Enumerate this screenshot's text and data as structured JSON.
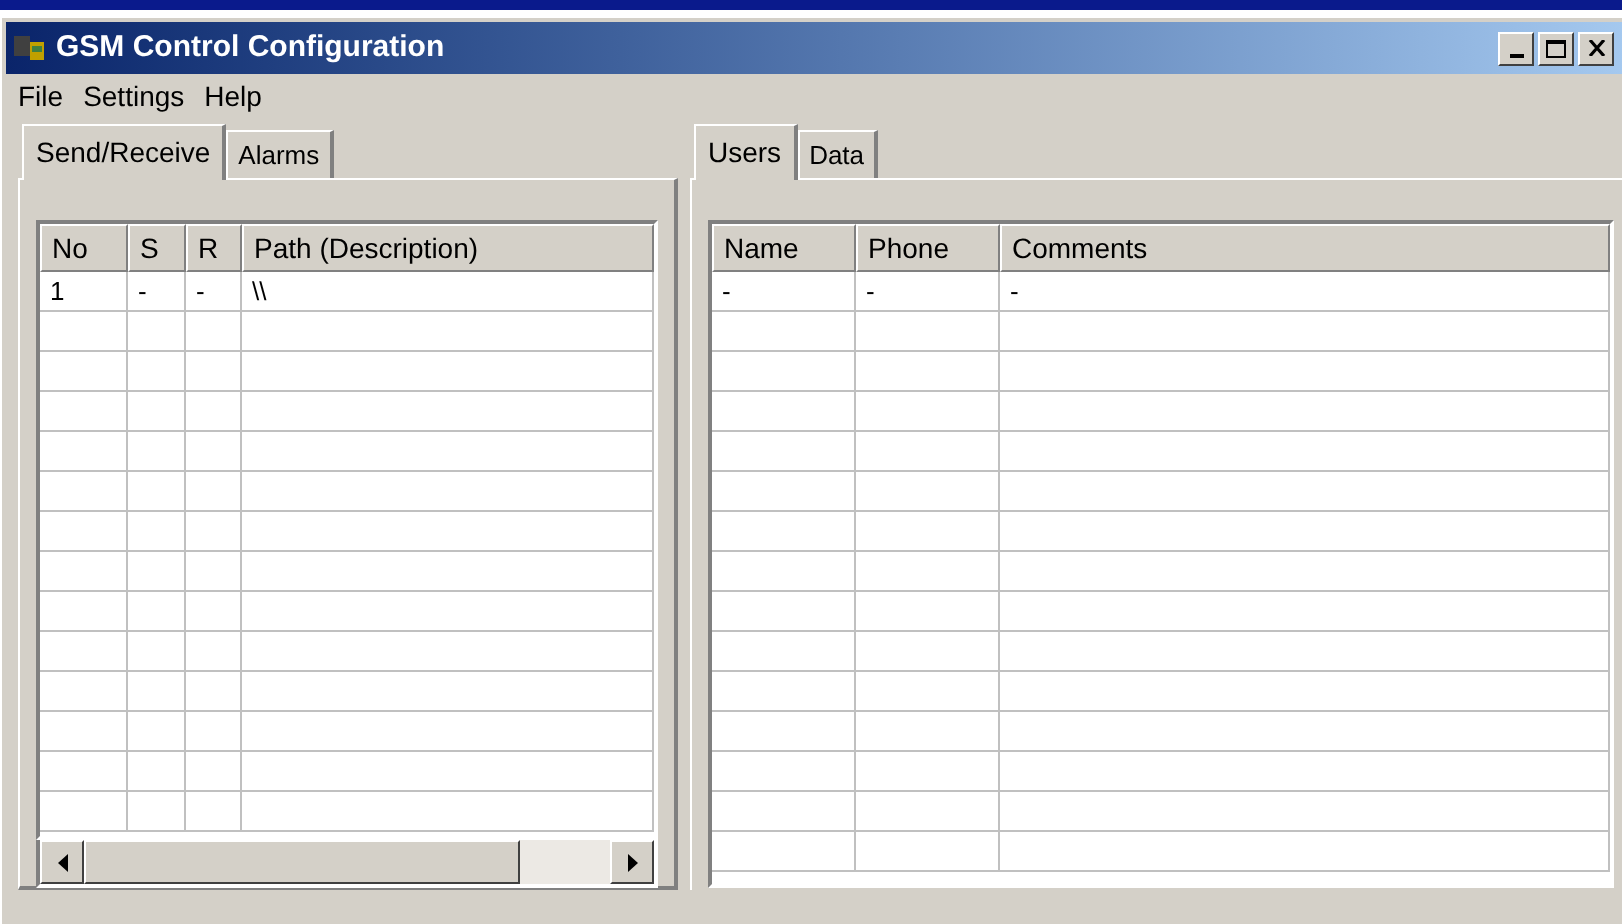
{
  "window": {
    "title": "GSM Control Configuration"
  },
  "menu": [
    "File",
    "Settings",
    "Help"
  ],
  "left_panel": {
    "tabs": [
      {
        "label": "Send/Receive",
        "selected": true
      },
      {
        "label": "Alarms",
        "selected": false
      }
    ],
    "table": {
      "columns": [
        "No",
        "S",
        "R",
        "Path (Description)"
      ],
      "rows": [
        [
          "1",
          "-",
          "-",
          "\\\\"
        ]
      ]
    }
  },
  "right_panel": {
    "tabs": [
      {
        "label": "Users",
        "selected": true
      },
      {
        "label": "Data",
        "selected": false
      }
    ],
    "table": {
      "columns": [
        "Name",
        "Phone",
        "Comments"
      ],
      "rows": [
        [
          "-",
          "-",
          "-"
        ]
      ]
    }
  }
}
